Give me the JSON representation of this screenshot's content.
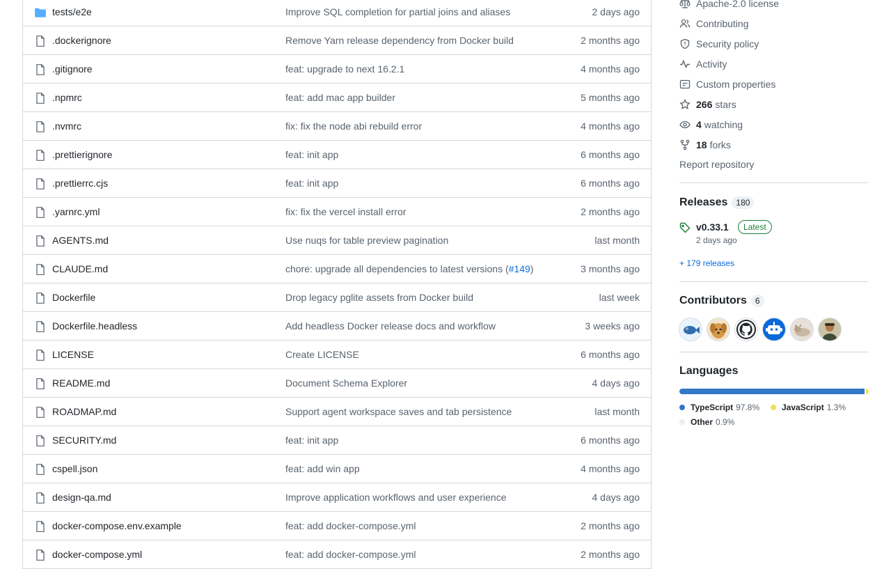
{
  "files": [
    {
      "name": "tests/e2e",
      "type": "dir",
      "message": "Improve SQL completion for partial joins and aliases",
      "pr": "",
      "age": "2 days ago"
    },
    {
      "name": ".dockerignore",
      "type": "file",
      "message": "Remove Yarn release dependency from Docker build",
      "pr": "",
      "age": "2 months ago"
    },
    {
      "name": ".gitignore",
      "type": "file",
      "message": "feat: upgrade to next 16.2.1",
      "pr": "",
      "age": "4 months ago"
    },
    {
      "name": ".npmrc",
      "type": "file",
      "message": "feat: add mac app builder",
      "pr": "",
      "age": "5 months ago"
    },
    {
      "name": ".nvmrc",
      "type": "file",
      "message": "fix: fix the node abi rebuild error",
      "pr": "",
      "age": "4 months ago"
    },
    {
      "name": ".prettierignore",
      "type": "file",
      "message": "feat: init app",
      "pr": "",
      "age": "6 months ago"
    },
    {
      "name": ".prettierrc.cjs",
      "type": "file",
      "message": "feat: init app",
      "pr": "",
      "age": "6 months ago"
    },
    {
      "name": ".yarnrc.yml",
      "type": "file",
      "message": "fix: fix the vercel install error",
      "pr": "",
      "age": "2 months ago"
    },
    {
      "name": "AGENTS.md",
      "type": "file",
      "message": "Use nuqs for table preview pagination",
      "pr": "",
      "age": "last month"
    },
    {
      "name": "CLAUDE.md",
      "type": "file",
      "message": "chore: upgrade all dependencies to latest versions (",
      "pr": "#149",
      "age": "3 months ago"
    },
    {
      "name": "Dockerfile",
      "type": "file",
      "message": "Drop legacy pglite assets from Docker build",
      "pr": "",
      "age": "last week"
    },
    {
      "name": "Dockerfile.headless",
      "type": "file",
      "message": "Add headless Docker release docs and workflow",
      "pr": "",
      "age": "3 weeks ago"
    },
    {
      "name": "LICENSE",
      "type": "file",
      "message": "Create LICENSE",
      "pr": "",
      "age": "6 months ago"
    },
    {
      "name": "README.md",
      "type": "file",
      "message": "Document Schema Explorer",
      "pr": "",
      "age": "4 days ago"
    },
    {
      "name": "ROADMAP.md",
      "type": "file",
      "message": "Support agent workspace saves and tab persistence",
      "pr": "",
      "age": "last month"
    },
    {
      "name": "SECURITY.md",
      "type": "file",
      "message": "feat: init app",
      "pr": "",
      "age": "6 months ago"
    },
    {
      "name": "cspell.json",
      "type": "file",
      "message": "feat: add win app",
      "pr": "",
      "age": "4 months ago"
    },
    {
      "name": "design-qa.md",
      "type": "file",
      "message": "Improve application workflows and user experience",
      "pr": "",
      "age": "4 days ago"
    },
    {
      "name": "docker-compose.env.example",
      "type": "file",
      "message": "feat: add docker-compose.yml",
      "pr": "",
      "age": "2 months ago"
    },
    {
      "name": "docker-compose.yml",
      "type": "file",
      "message": "feat: add docker-compose.yml",
      "pr": "",
      "age": "2 months ago"
    }
  ],
  "sidebar": {
    "license": "Apache-2.0 license",
    "contributing": "Contributing",
    "security": "Security policy",
    "activity": "Activity",
    "custom_properties": "Custom properties",
    "stars_count": "266",
    "stars_label": "stars",
    "watching_count": "4",
    "watching_label": "watching",
    "forks_count": "18",
    "forks_label": "forks",
    "report": "Report repository",
    "releases": {
      "title": "Releases",
      "count": "180",
      "latest_name": "v0.33.1",
      "latest_badge": "Latest",
      "latest_date": "2 days ago",
      "more_link": "+ 179 releases"
    },
    "contributors": {
      "title": "Contributors",
      "count": "6",
      "avatars": [
        "fish-avatar",
        "dog-avatar",
        "github-avatar",
        "bot-avatar",
        "cat-avatar",
        "person-avatar"
      ]
    },
    "languages": {
      "title": "Languages",
      "items": [
        {
          "name": "TypeScript",
          "percent": "97.8%",
          "value": 97.8,
          "color": "#3178c6"
        },
        {
          "name": "JavaScript",
          "percent": "1.3%",
          "value": 1.3,
          "color": "#f1e05a"
        },
        {
          "name": "Other",
          "percent": "0.9%",
          "value": 0.9,
          "color": "#ededed"
        }
      ]
    }
  }
}
